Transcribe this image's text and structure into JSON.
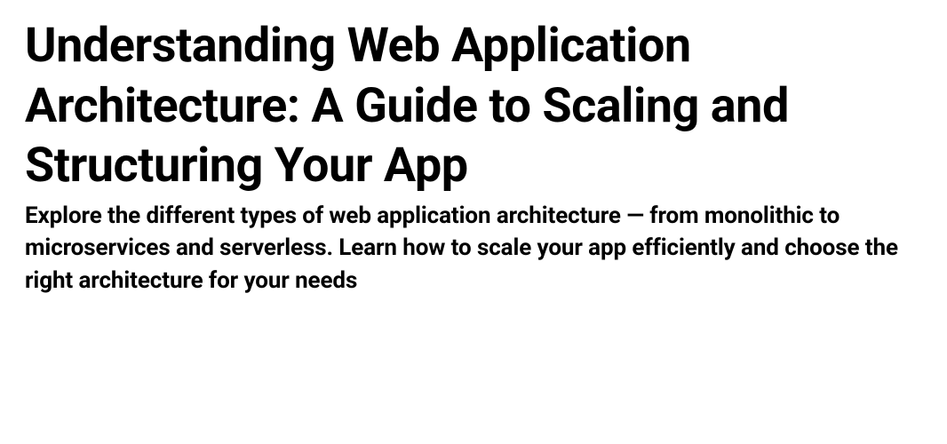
{
  "article": {
    "title": "Understanding Web Application Architecture: A Guide to Scaling and Structuring Your App",
    "subtitle": "Explore the different types of web application architecture — from monolithic to microservices and serverless. Learn how to scale your app efficiently and choose the right architecture for your needs"
  }
}
